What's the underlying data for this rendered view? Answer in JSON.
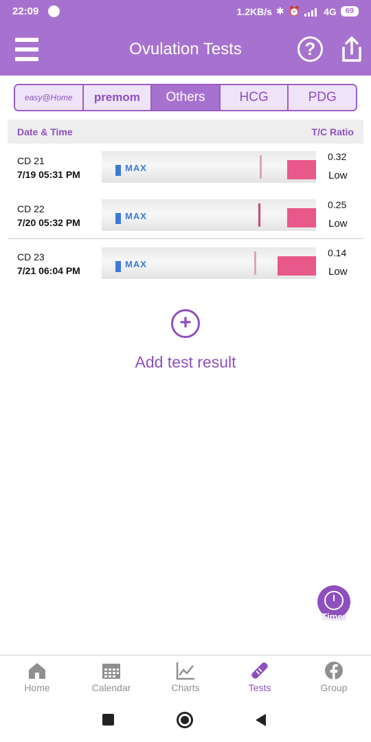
{
  "status_bar": {
    "time": "22:09",
    "network_speed": "1.2KB/s",
    "network_type": "4G",
    "battery": "69"
  },
  "app_bar": {
    "title": "Ovulation Tests"
  },
  "tabs": [
    {
      "label": "easy@Home",
      "active": false
    },
    {
      "label": "premom",
      "active": false
    },
    {
      "label": "Others",
      "active": true
    },
    {
      "label": "HCG",
      "active": false
    },
    {
      "label": "PDG",
      "active": false
    }
  ],
  "table": {
    "header_date": "Date & Time",
    "header_ratio": "T/C Ratio",
    "rows": [
      {
        "cycle_day": "CD 21",
        "datetime": "7/19   05:31 PM",
        "ratio": "0.32",
        "level": "Low"
      },
      {
        "cycle_day": "CD 22",
        "datetime": "7/20   05:32 PM",
        "ratio": "0.25",
        "level": "Low"
      },
      {
        "cycle_day": "CD 23",
        "datetime": "7/21   06:04 PM",
        "ratio": "0.14",
        "level": "Low"
      }
    ]
  },
  "strip_label": "MAX",
  "add_label": "Add test result",
  "timer_label": "Timer",
  "bottom_nav": [
    {
      "label": "Home",
      "icon": "home-icon",
      "active": false
    },
    {
      "label": "Calendar",
      "icon": "calendar-icon",
      "active": false
    },
    {
      "label": "Charts",
      "icon": "charts-icon",
      "active": false
    },
    {
      "label": "Tests",
      "icon": "test-strip-icon",
      "active": true
    },
    {
      "label": "Group",
      "icon": "facebook-icon",
      "active": false
    }
  ],
  "colors": {
    "primary": "#a772cf",
    "accent": "#8e4fbf",
    "strip_handle": "#e8588a"
  }
}
